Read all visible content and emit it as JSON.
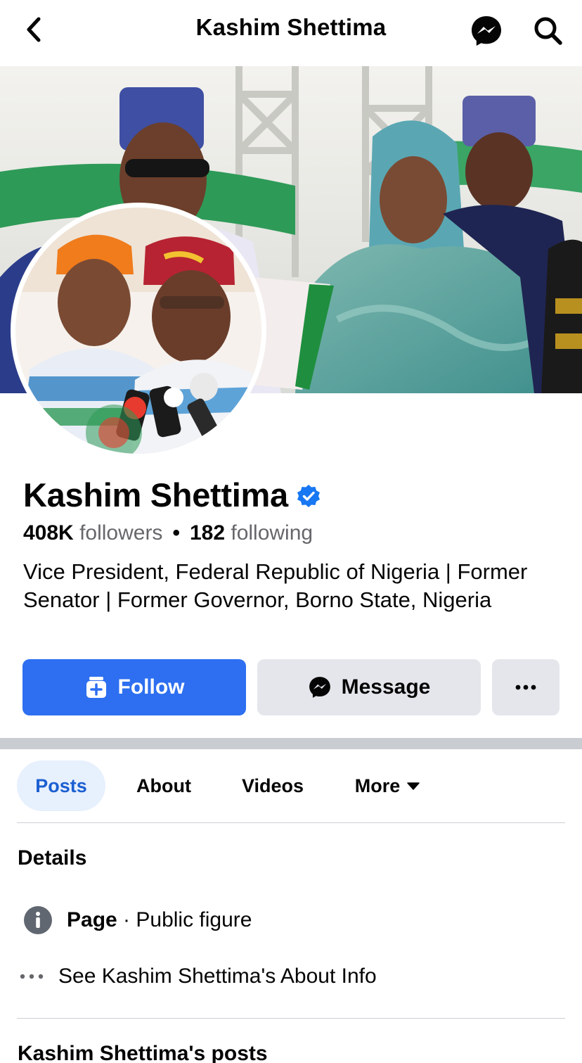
{
  "header": {
    "title": "Kashim Shettima",
    "back_icon": "chevron-left-icon",
    "messenger_icon": "messenger-icon",
    "search_icon": "search-icon"
  },
  "profile": {
    "name": "Kashim Shettima",
    "verified": true,
    "followers_count": "408K",
    "followers_label": "followers",
    "separator": "•",
    "following_count": "182",
    "following_label": "following",
    "bio": "Vice President, Federal Republic of Nigeria | Former Senator | Former Governor, Borno State, Nigeria"
  },
  "actions": {
    "follow_label": "Follow",
    "message_label": "Message",
    "more_label": "•••"
  },
  "tabs": [
    {
      "label": "Posts",
      "active": true
    },
    {
      "label": "About",
      "active": false
    },
    {
      "label": "Videos",
      "active": false
    },
    {
      "label": "More",
      "active": false
    }
  ],
  "details": {
    "title": "Details",
    "page_label": "Page",
    "page_category": " · Public figure",
    "about_link": "See Kashim Shettima's About Info"
  },
  "posts_section": {
    "title": "Kashim Shettima's posts"
  },
  "colors": {
    "accent": "#2d6ff0",
    "verified": "#1877f2",
    "button_gray": "#e4e6eb",
    "tab_active_bg": "#e7f0fd",
    "tab_active_text": "#1b5fd1"
  }
}
